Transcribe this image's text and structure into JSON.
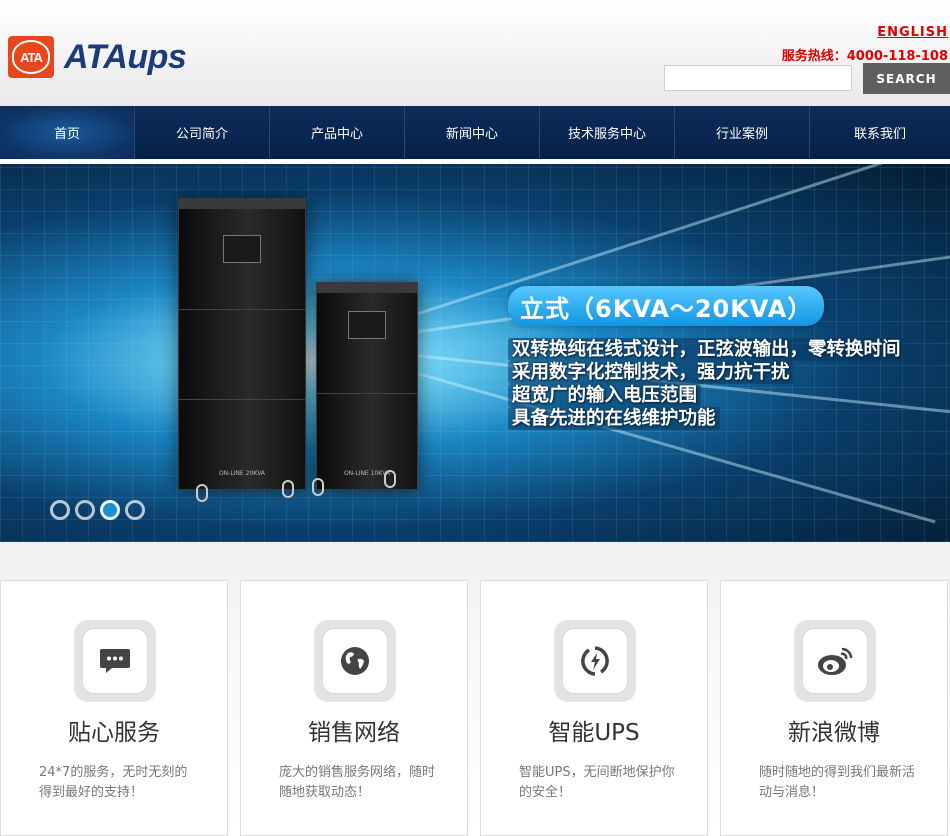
{
  "header": {
    "logo_badge": "ATA",
    "logo_text": "ATAups",
    "english_link": "ENGLISH",
    "hotline": "服务热线：4000-118-108",
    "search_placeholder": "",
    "search_button": "SEARCH"
  },
  "nav": {
    "items": [
      {
        "label": "首页",
        "active": true
      },
      {
        "label": "公司简介"
      },
      {
        "label": "产品中心"
      },
      {
        "label": "新闻中心"
      },
      {
        "label": "技术服务中心"
      },
      {
        "label": "行业案例"
      },
      {
        "label": "联系我们"
      }
    ]
  },
  "banner": {
    "title": "立式（6KVA～20KVA）",
    "lines": [
      "双转换纯在线式设计，正弦波输出，零转换时间",
      "采用数字化控制技术，强力抗干扰",
      "超宽广的输入电压范围",
      "具备先进的在线维护功能"
    ],
    "ups_big_label": "ON-LINE 20KVA",
    "ups_small_label": "ON-LINE 10KVA",
    "slide_count": 4,
    "active_slide": 3
  },
  "features": [
    {
      "icon": "chat-bubble-icon",
      "title": "贴心服务",
      "desc": "24*7的服务，无时无刻的得到最好的支持！"
    },
    {
      "icon": "globe-icon",
      "title": "销售网络",
      "desc": "庞大的销售服务网络，随时随地获取动态！"
    },
    {
      "icon": "power-bolt-icon",
      "title": "智能UPS",
      "desc": "智能UPS，无间断地保护你的安全！"
    },
    {
      "icon": "weibo-icon",
      "title": "新浪微博",
      "desc": "随时随地的得到我们最新活动与消息！"
    }
  ],
  "colors": {
    "brand_orange": "#e8461b",
    "brand_blue": "#1d3b7a",
    "nav_bg": "#0d2b5a",
    "accent_red": "#e00000",
    "banner_badge": "#1196e3"
  }
}
